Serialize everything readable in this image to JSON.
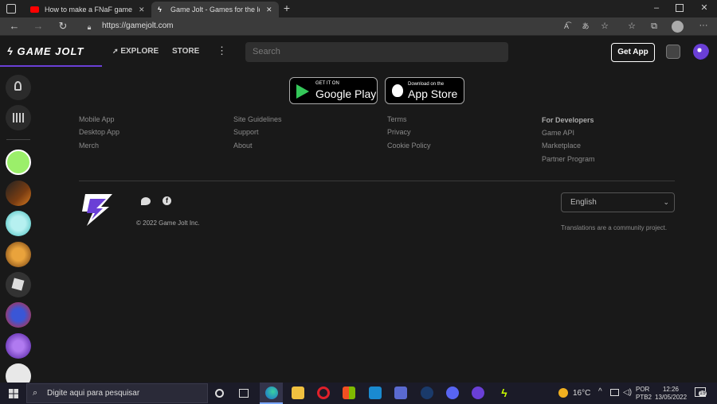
{
  "browser": {
    "tabs": [
      {
        "title": "How to make a FNaF game in Cl"
      },
      {
        "title": "Game Jolt - Games for the love o"
      }
    ],
    "address": "https://gamejolt.com"
  },
  "header": {
    "logo": "GAME JOLT",
    "nav_explore": "EXPLORE",
    "nav_store": "STORE",
    "more": "⋮",
    "search_placeholder": "Search",
    "get_app": "Get App"
  },
  "store_buttons": {
    "google_small": "GET IT ON",
    "google_big": "Google Play",
    "apple_small": "Download on the",
    "apple_big": "App Store"
  },
  "footer": {
    "col1": [
      "Mobile App",
      "Desktop App",
      "Merch"
    ],
    "col2": [
      "Site Guidelines",
      "Support",
      "About"
    ],
    "col3": [
      "Terms",
      "Privacy",
      "Cookie Policy"
    ],
    "col4_title": "For Developers",
    "col4": [
      "Game API",
      "Marketplace",
      "Partner Program"
    ],
    "copyright": "© 2022 Game Jolt Inc.",
    "language": "English",
    "translations_note": "Translations are a community project."
  },
  "taskbar": {
    "search_placeholder": "Digite aqui para pesquisar",
    "temperature": "16°C",
    "lang1": "POR",
    "lang2": "PTB2",
    "time": "12:26",
    "date": "13/05/2022",
    "notif_count": "19"
  },
  "colors": {
    "brand_accent": "#2f7f6f",
    "gj_purple": "#6a3fd6",
    "gj_green": "#ccff00"
  }
}
